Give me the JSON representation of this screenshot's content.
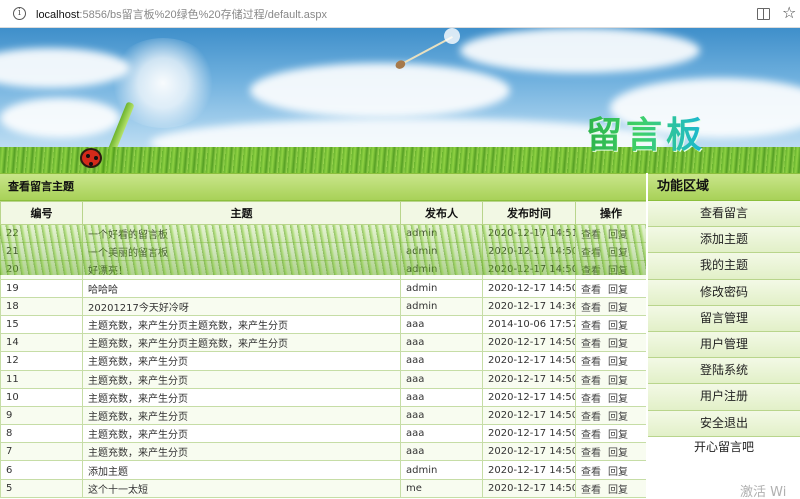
{
  "browser": {
    "url_host": "localhost",
    "url_path": ":5856/bs留言板%20绿色%20存储过程/default.aspx"
  },
  "banner": {
    "title": "留言板"
  },
  "main": {
    "heading": "查看留言主题",
    "columns": [
      "编号",
      "主题",
      "发布人",
      "发布时间",
      "操作"
    ],
    "action_view": "查看",
    "action_reply": "回复",
    "rows": [
      {
        "id": "22",
        "title": "一个好看的留言板",
        "author": "admin",
        "time": "2020-12-17 14:51"
      },
      {
        "id": "21",
        "title": "一个美丽的留言板",
        "author": "admin",
        "time": "2020-12-17 14:50"
      },
      {
        "id": "20",
        "title": "好漂亮！",
        "author": "admin",
        "time": "2020-12-17 14:50"
      },
      {
        "id": "19",
        "title": "哈哈哈",
        "author": "admin",
        "time": "2020-12-17 14:50"
      },
      {
        "id": "18",
        "title": "20201217今天好冷呀",
        "author": "admin",
        "time": "2020-12-17 14:36"
      },
      {
        "id": "15",
        "title": "主题充数，来产生分页主题充数，来产生分页",
        "author": "aaa",
        "time": "2014-10-06 17:57"
      },
      {
        "id": "14",
        "title": "主题充数，来产生分页主题充数，来产生分页",
        "author": "aaa",
        "time": "2020-12-17 14:50"
      },
      {
        "id": "12",
        "title": "主题充数，来产生分页",
        "author": "aaa",
        "time": "2020-12-17 14:50"
      },
      {
        "id": "11",
        "title": "主题充数，来产生分页",
        "author": "aaa",
        "time": "2020-12-17 14:50"
      },
      {
        "id": "10",
        "title": "主题充数，来产生分页",
        "author": "aaa",
        "time": "2020-12-17 14:50"
      },
      {
        "id": "9",
        "title": "主题充数，来产生分页",
        "author": "aaa",
        "time": "2020-12-17 14:50"
      },
      {
        "id": "8",
        "title": "主题充数，来产生分页",
        "author": "aaa",
        "time": "2020-12-17 14:50"
      },
      {
        "id": "7",
        "title": "主题充数，来产生分页",
        "author": "aaa",
        "time": "2020-12-17 14:50"
      },
      {
        "id": "6",
        "title": "添加主题",
        "author": "admin",
        "time": "2020-12-17 14:50"
      },
      {
        "id": "5",
        "title": "这个十一太短",
        "author": "me",
        "time": "2020-12-17 14:50"
      }
    ]
  },
  "side": {
    "heading": "功能区域",
    "items": [
      "查看留言",
      "添加主题",
      "我的主题",
      "修改密码",
      "留言管理",
      "用户管理",
      "登陆系统",
      "用户注册",
      "安全退出"
    ],
    "footer": "开心留言吧"
  },
  "watermark": "激活 Wi"
}
